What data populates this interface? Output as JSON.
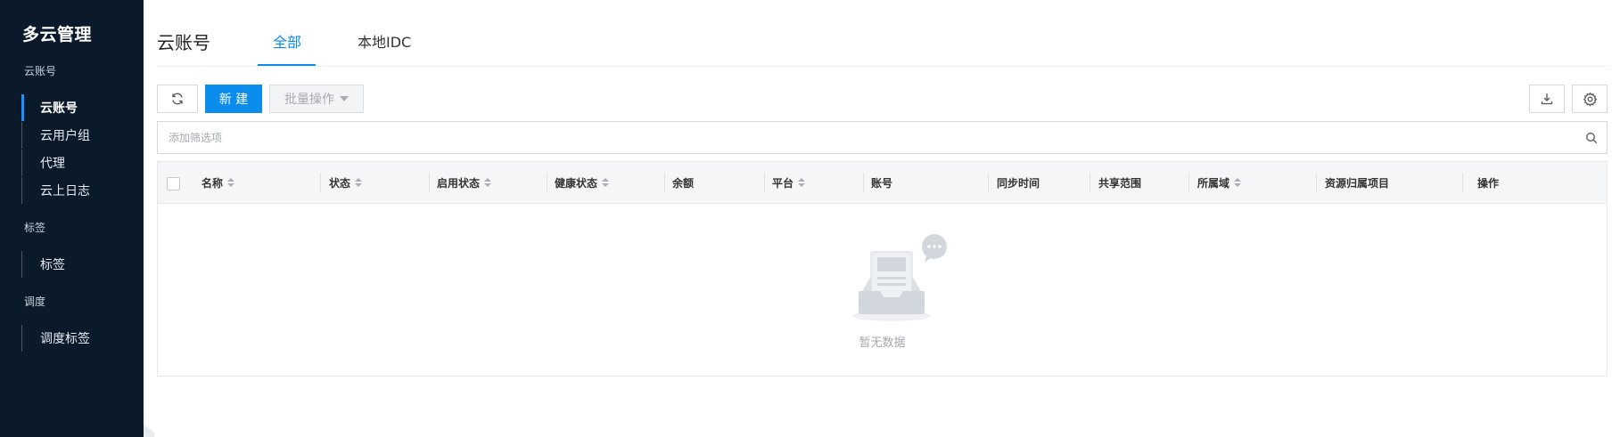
{
  "sidebar": {
    "title": "多云管理",
    "groups": [
      {
        "label": "云账号",
        "items": [
          {
            "label": "云账号",
            "active": true
          },
          {
            "label": "云用户组"
          },
          {
            "label": "代理"
          },
          {
            "label": "云上日志"
          }
        ]
      },
      {
        "label": "标签",
        "items": [
          {
            "label": "标签"
          }
        ]
      },
      {
        "label": "调度",
        "items": [
          {
            "label": "调度标签"
          }
        ]
      }
    ]
  },
  "header": {
    "title": "云账号",
    "tabs": [
      {
        "label": "全部",
        "active": true
      },
      {
        "label": "本地IDC"
      }
    ]
  },
  "toolbar": {
    "refresh_icon": "refresh-icon",
    "new_label": "新 建",
    "batch_label": "批量操作",
    "download_icon": "download-icon",
    "settings_icon": "gear-icon"
  },
  "filter": {
    "placeholder": "添加筛选项",
    "icon": "search-icon"
  },
  "table": {
    "columns": [
      {
        "label": "名称",
        "sortable": true
      },
      {
        "label": "状态",
        "sortable": true
      },
      {
        "label": "启用状态",
        "sortable": true
      },
      {
        "label": "健康状态",
        "sortable": true
      },
      {
        "label": "余额",
        "sortable": false
      },
      {
        "label": "平台",
        "sortable": true
      },
      {
        "label": "账号",
        "sortable": false
      },
      {
        "label": "同步时间",
        "sortable": false
      },
      {
        "label": "共享范围",
        "sortable": false
      },
      {
        "label": "所属域",
        "sortable": true
      },
      {
        "label": "资源归属项目",
        "sortable": false
      },
      {
        "label": "操作",
        "sortable": false
      }
    ],
    "rows": [],
    "empty_text": "暂无数据"
  },
  "colors": {
    "accent": "#0a8ded",
    "sidebar_bg": "#0b1a2b"
  }
}
